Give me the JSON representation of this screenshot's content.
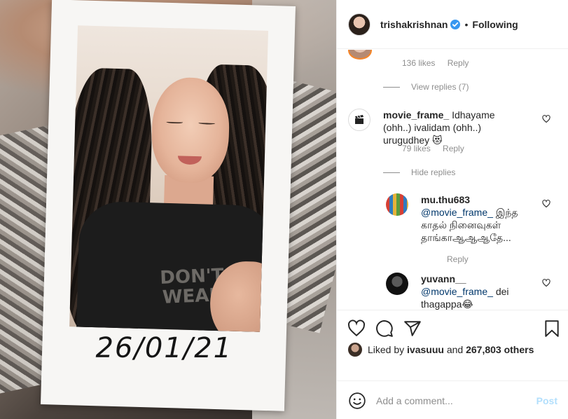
{
  "post": {
    "polaroid_caption": "26/01/21",
    "shirt_print": "DON'T WEAR",
    "username": "trishakrishnan",
    "separator": "•",
    "follow_status": "Following"
  },
  "comments": {
    "top_meta": {
      "likes": "136 likes",
      "reply": "Reply"
    },
    "view_replies": "View replies (7)",
    "comment1": {
      "username": "movie_frame_",
      "text": "Idhayame (ohh..) ivalidam (ohh..) urugudhey 😻",
      "likes": "79 likes",
      "reply": "Reply"
    },
    "hide_replies": "Hide replies",
    "reply1": {
      "username": "mu.thu683",
      "mention": "@movie_frame_",
      "text": "இந்த காதல் நினைவுகள் தாங்காஆஆஆதே...",
      "reply": "Reply"
    },
    "reply2": {
      "username": "yuvann__",
      "mention": "@movie_frame_",
      "text": "dei thagappa😂"
    }
  },
  "likes": {
    "prefix": "Liked by",
    "liker": "ivasuuu",
    "middle": "and",
    "count": "267,803 others"
  },
  "add_comment": {
    "placeholder": "Add a comment...",
    "post_label": "Post"
  },
  "colors": {
    "link": "#00376b",
    "muted": "#8e8e8e",
    "post_disabled": "#b2dffc",
    "verified": "#3897f0"
  },
  "icons": [
    "verified-icon",
    "heart-icon",
    "comment-icon",
    "share-icon",
    "bookmark-icon",
    "emoji-icon",
    "clapperboard-icon"
  ]
}
